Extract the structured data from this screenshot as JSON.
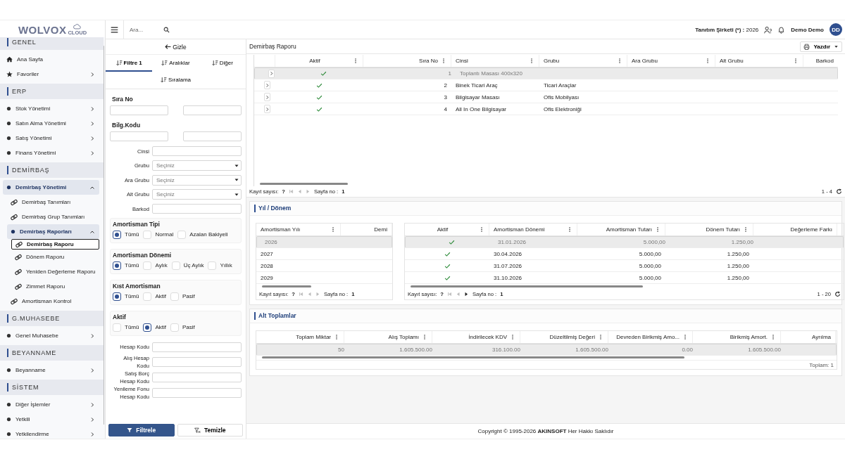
{
  "sidebar": {
    "logo": "WOLVOX",
    "logo_sub": "CLOUD",
    "sections": [
      {
        "title": "GENEL",
        "items": [
          {
            "label": "Ana Sayfa",
            "kind": "home",
            "selected": false
          },
          {
            "label": "Favoriler",
            "kind": "star",
            "expanded": false,
            "selected": false
          }
        ]
      },
      {
        "title": "ERP",
        "items": [
          {
            "label": "Stok Yönetimi",
            "kind": "module",
            "expanded": false,
            "selected": false
          },
          {
            "label": "Satın Alma Yönetimi",
            "kind": "module",
            "expanded": false,
            "selected": false
          },
          {
            "label": "Satış Yönetimi",
            "kind": "module",
            "expanded": false,
            "selected": false
          },
          {
            "label": "Finans Yönetimi",
            "kind": "module",
            "expanded": false,
            "selected": false
          }
        ]
      },
      {
        "title": "DEMİRBAŞ",
        "items": [
          {
            "label": "Demirbaş Yönetimi",
            "kind": "module",
            "expanded": true,
            "selected": false,
            "children": [
              {
                "label": "Demirbaş Tanımları",
                "kind": "page",
                "selected": false
              },
              {
                "label": "Demirbaş Grup Tanımları",
                "kind": "page",
                "selected": false
              },
              {
                "label": "Demirbaş Raporları",
                "kind": "module",
                "expanded": true,
                "selected": false,
                "children": [
                  {
                    "label": "Demirbaş Raporu",
                    "kind": "page",
                    "selected": true
                  },
                  {
                    "label": "Dönem Raporu",
                    "kind": "page",
                    "selected": false
                  },
                  {
                    "label": "Yeniden Değerleme Raporu",
                    "kind": "page",
                    "selected": false
                  },
                  {
                    "label": "Zimmet Raporu",
                    "kind": "page",
                    "selected": false
                  }
                ]
              },
              {
                "label": "Amortisman Kontrol",
                "kind": "page",
                "selected": false
              }
            ]
          }
        ]
      },
      {
        "title": "G.MUHASEBE",
        "items": [
          {
            "label": "Genel Muhasebe",
            "kind": "module",
            "expanded": false,
            "selected": false
          }
        ]
      },
      {
        "title": "BEYANNAME",
        "items": [
          {
            "label": "Beyanname",
            "kind": "module",
            "expanded": false,
            "selected": false
          }
        ]
      },
      {
        "title": "SİSTEM",
        "items": [
          {
            "label": "Diğer İşlemler",
            "kind": "module",
            "expanded": false,
            "selected": false
          },
          {
            "label": "Yetkili",
            "kind": "module",
            "expanded": false,
            "selected": false
          },
          {
            "label": "Yetkilendirme",
            "kind": "module",
            "expanded": false,
            "selected": false
          }
        ]
      }
    ]
  },
  "header": {
    "search_placeholder": "Ara...",
    "company": "Tanıtım Şirketi (*) :",
    "year": "2026",
    "user": "Demo Demo",
    "avatar": "DD"
  },
  "filter": {
    "hide_button": "Gizle",
    "tabs": [
      {
        "label": "Filtre 1",
        "selected": true
      },
      {
        "label": "Aralıklar",
        "selected": false
      },
      {
        "label": "Diğer",
        "selected": false
      },
      {
        "label": "Sıralama",
        "selected": false
      }
    ],
    "fields": [
      {
        "kind": "range",
        "label": "Sıra No"
      },
      {
        "kind": "range",
        "label": "Bilg.Kodu"
      },
      {
        "kind": "text",
        "label": "Cinsi"
      },
      {
        "kind": "select",
        "label": "Grubu",
        "placeholder": "Seçiniz"
      },
      {
        "kind": "select",
        "label": "Ara Grubu",
        "placeholder": "Seçiniz"
      },
      {
        "kind": "select",
        "label": "Alt Grubu",
        "placeholder": "Seçiniz"
      },
      {
        "kind": "text",
        "label": "Barkod"
      },
      {
        "kind": "radio",
        "label": "Amortisman Tipi",
        "options": [
          {
            "label": "Tümü",
            "checked": true
          },
          {
            "label": "Normal",
            "checked": false
          },
          {
            "label": "Azalan Bakiyeli",
            "checked": false
          }
        ]
      },
      {
        "kind": "radio",
        "label": "Amortisman Dönemi",
        "options": [
          {
            "label": "Tümü",
            "checked": true
          },
          {
            "label": "Aylık",
            "checked": false
          },
          {
            "label": "Üç Aylık",
            "checked": false
          },
          {
            "label": "Yıllık",
            "checked": false
          }
        ]
      },
      {
        "kind": "radio",
        "label": "Kıst Amortisman",
        "options": [
          {
            "label": "Tümü",
            "checked": true
          },
          {
            "label": "Aktif",
            "checked": false
          },
          {
            "label": "Pasif",
            "checked": false
          }
        ]
      },
      {
        "kind": "radio",
        "label": "Aktif",
        "options": [
          {
            "label": "Tümü",
            "checked": false
          },
          {
            "label": "Aktif",
            "checked": true
          },
          {
            "label": "Pasif",
            "checked": false
          }
        ]
      },
      {
        "kind": "text",
        "label": "Hesap Kodu"
      },
      {
        "kind": "text",
        "label": "Alış Hesap Kodu"
      },
      {
        "kind": "text",
        "label": "Satış Borç\nHesap Kodu"
      },
      {
        "kind": "text",
        "label": "Yenileme Fonu\nHesap Kodu"
      }
    ],
    "apply_button": "Filtrele",
    "clear_button": "Temizle"
  },
  "report": {
    "title": "Demirbaş Raporu",
    "print_button": "Yazdır",
    "grid": {
      "columns": [
        {
          "label": "Aktif",
          "kind": "check",
          "menu": true
        },
        {
          "label": "Sıra No",
          "kind": "number",
          "menu": true
        },
        {
          "label": "Cinsi",
          "kind": "text",
          "menu": true
        },
        {
          "label": "Grubu",
          "kind": "text",
          "menu": true
        },
        {
          "label": "Ara Grubu",
          "kind": "text",
          "menu": true
        },
        {
          "label": "Alt Grubu",
          "kind": "text",
          "menu": true
        },
        {
          "label": "Barkod",
          "kind": "edge",
          "menu": false
        }
      ],
      "rows": [
        {
          "selected": true,
          "aktif": true,
          "cells": [
            "",
            "1",
            "Toplantı Masası 400x320"
          ]
        },
        {
          "selected": false,
          "aktif": true,
          "cells": [
            "",
            "2",
            "Binek Ticari Araç",
            "Ticari Araçlar"
          ]
        },
        {
          "selected": false,
          "aktif": true,
          "cells": [
            "",
            "3",
            "Bilgisayar Masası",
            "Ofis Mobilyası"
          ]
        },
        {
          "selected": false,
          "aktif": true,
          "cells": [
            "",
            "4",
            "All In One Bilgisayar",
            "Ofis Elektroniği"
          ]
        }
      ]
    },
    "pager": {
      "count_label": "Kayıt sayısı:",
      "count": "?",
      "page_label": "Sayfa no :",
      "page": "1",
      "range": "1 - 4",
      "next_enabled": false
    }
  },
  "periods": {
    "title": "Yıl / Dönem",
    "years": {
      "columns": [
        {
          "label": "Amortisman Yılı",
          "kind": "text",
          "menu": true
        },
        {
          "label": "Demi",
          "kind": "edge",
          "menu": false
        }
      ],
      "rows": [
        {
          "selected": true,
          "cells": [
            "2026"
          ]
        },
        {
          "selected": false,
          "cells": [
            "2027"
          ]
        },
        {
          "selected": false,
          "cells": [
            "2028"
          ]
        },
        {
          "selected": false,
          "cells": [
            "2029"
          ]
        }
      ]
    },
    "years_pager": {
      "count_label": "Kayıt sayısı:",
      "count": "?",
      "page_label": "Sayfa no :",
      "page": "1",
      "next_enabled": false
    },
    "schedule": {
      "columns": [
        {
          "label": "Aktif",
          "kind": "check",
          "menu": true
        },
        {
          "label": "Amortisman Dönemi",
          "kind": "text",
          "menu": true
        },
        {
          "label": "Amortisman Tutarı",
          "kind": "number",
          "menu": true
        },
        {
          "label": "Dönem Tutarı",
          "kind": "number",
          "menu": true
        },
        {
          "label": "Değerleme Farkı",
          "kind": "edge",
          "menu": false
        }
      ],
      "rows": [
        {
          "selected": true,
          "aktif": true,
          "cells": [
            "",
            "31.01.2026",
            "5.000,00",
            "1.250,00"
          ]
        },
        {
          "selected": false,
          "aktif": true,
          "cells": [
            "",
            "30.04.2026",
            "5.000,00",
            "1.250,00"
          ]
        },
        {
          "selected": false,
          "aktif": true,
          "cells": [
            "",
            "31.07.2026",
            "5.000,00",
            "1.250,00"
          ]
        },
        {
          "selected": false,
          "aktif": true,
          "cells": [
            "",
            "31.10.2026",
            "5.000,00",
            "1.250,00"
          ]
        }
      ]
    },
    "schedule_pager": {
      "count_label": "Kayıt sayısı:",
      "count": "?",
      "page_label": "Sayfa no :",
      "page": "1",
      "range": "1 - 20",
      "next_enabled": true
    }
  },
  "totals": {
    "title": "Alt Toplamlar",
    "grid": {
      "columns": [
        {
          "label": "Toplam Miktar",
          "kind": "number",
          "menu": true
        },
        {
          "label": "Alış Toplamı",
          "kind": "number",
          "menu": true
        },
        {
          "label": "İndirilecek KDV",
          "kind": "number",
          "menu": true
        },
        {
          "label": "Düzeltilmiş Değeri",
          "kind": "number",
          "menu": true
        },
        {
          "label": "Devreden Birikmiş Amo...",
          "kind": "number",
          "menu": true
        },
        {
          "label": "Birikmiş Amort.",
          "kind": "number",
          "menu": true
        },
        {
          "label": "Ayrılma",
          "kind": "edge",
          "menu": false
        }
      ],
      "rows": [
        {
          "selected": true,
          "cells": [
            "50",
            "1.605.500.00",
            "316.100.00",
            "1.605.500.00",
            "0.00",
            "1.605.500.00"
          ]
        }
      ]
    },
    "footer": "Toplam: 1"
  },
  "copyright": "Copyright © 1995-2026 **AKINSOFT** Her Hakkı Saklıdır"
}
